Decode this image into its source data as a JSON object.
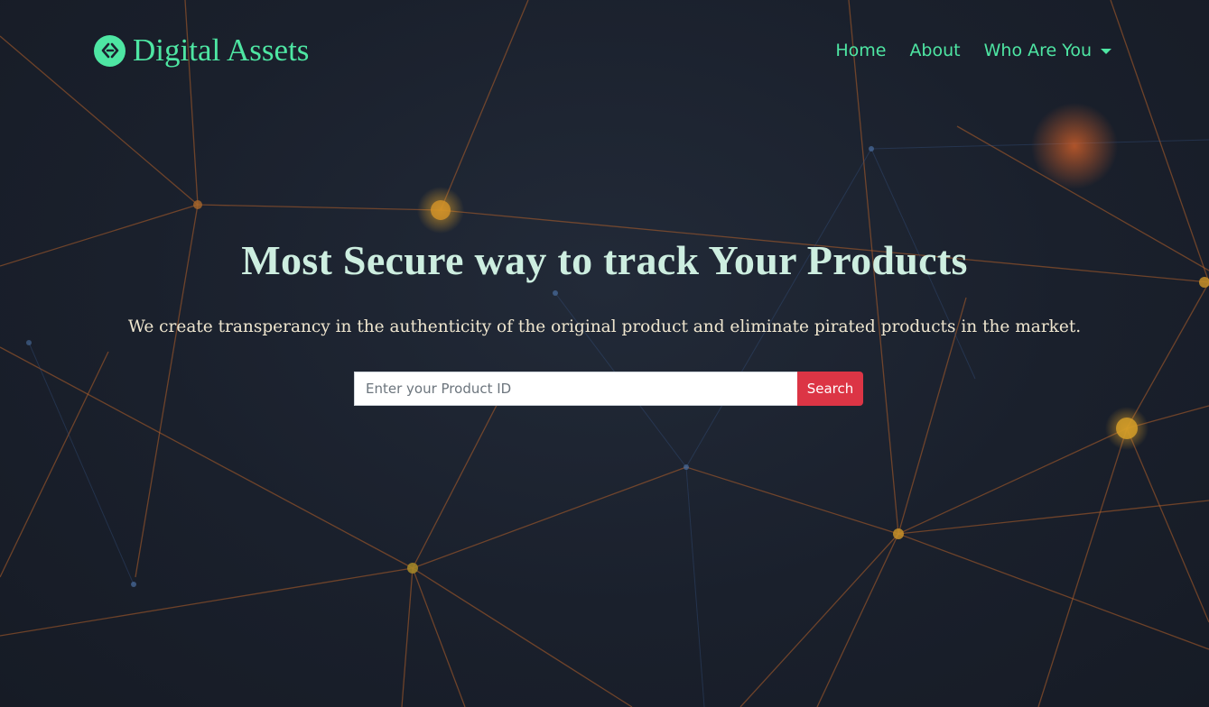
{
  "navbar": {
    "brand_icon": "diamond-link-icon",
    "brand_name": "Digital Assets",
    "links": {
      "home": "Home",
      "about": "About",
      "who_are_you": "Who Are You"
    }
  },
  "hero": {
    "title": "Most Secure way to track Your Products",
    "subtitle": "We create transperancy in the authenticity of the original product and eliminate pirated products in the market."
  },
  "search": {
    "placeholder": "Enter your Product ID",
    "value": "",
    "button_label": "Search"
  },
  "colors": {
    "accent": "#4ee6a3",
    "button": "#dc3545",
    "background": "#1b2230",
    "title_text": "#cdeee0",
    "subtitle_text": "#efe6cf"
  }
}
